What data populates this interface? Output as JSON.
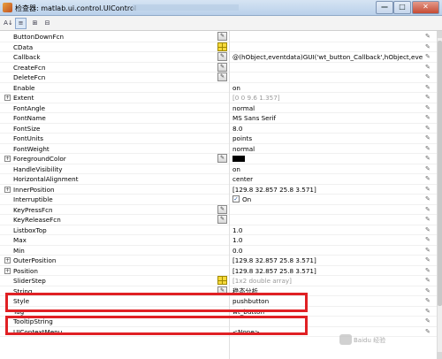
{
  "window": {
    "title": "检查器: matlab.ui.control.UIControl",
    "close_glyph": "✕",
    "min_glyph": "—",
    "max_glyph": "□"
  },
  "toolbar": {
    "buttons": [
      {
        "icon": "sort-categorized-icon",
        "glyph": "A↓"
      },
      {
        "icon": "sort-alphabetical-icon",
        "glyph": "≡"
      },
      {
        "icon": "expand-all-icon",
        "glyph": "⊞"
      },
      {
        "icon": "collapse-all-icon",
        "glyph": "⊟"
      }
    ]
  },
  "properties": [
    {
      "name": "ButtonDownFcn",
      "value": "",
      "edit": true
    },
    {
      "name": "CData",
      "value": "",
      "grid": true
    },
    {
      "name": "Callback",
      "value": "@(hObject,eventdata)GUI('wt_button_Callback',hObject,eventd...",
      "edit": true
    },
    {
      "name": "CreateFcn",
      "value": "",
      "edit": true
    },
    {
      "name": "DeleteFcn",
      "value": "",
      "edit": true
    },
    {
      "name": "Enable",
      "value": "on"
    },
    {
      "name": "Extent",
      "value": "[0 0 9.6 1.357]",
      "dim": true,
      "expand": true
    },
    {
      "name": "FontAngle",
      "value": "normal"
    },
    {
      "name": "FontName",
      "value": "MS Sans Serif"
    },
    {
      "name": "FontSize",
      "value": "8.0"
    },
    {
      "name": "FontUnits",
      "value": "points"
    },
    {
      "name": "FontWeight",
      "value": "normal"
    },
    {
      "name": "ForegroundColor",
      "value": "",
      "swatch": "#000000",
      "edit": true,
      "expand": true
    },
    {
      "name": "HandleVisibility",
      "value": "on"
    },
    {
      "name": "HorizontalAlignment",
      "value": "center"
    },
    {
      "name": "InnerPosition",
      "value": "[129.8 32.857 25.8 3.571]",
      "expand": true
    },
    {
      "name": "Interruptible",
      "value": "On",
      "checkbox": true
    },
    {
      "name": "KeyPressFcn",
      "value": "",
      "edit": true
    },
    {
      "name": "KeyReleaseFcn",
      "value": "",
      "edit": true
    },
    {
      "name": "ListboxTop",
      "value": "1.0"
    },
    {
      "name": "Max",
      "value": "1.0"
    },
    {
      "name": "Min",
      "value": "0.0"
    },
    {
      "name": "OuterPosition",
      "value": "[129.8 32.857 25.8 3.571]",
      "expand": true
    },
    {
      "name": "Position",
      "value": "[129.8 32.857 25.8 3.571]",
      "expand": true
    },
    {
      "name": "SliderStep",
      "value": "[1x2 double array]",
      "dim": true,
      "grid": true
    },
    {
      "name": "String",
      "value": "稳态分析",
      "edit": true
    },
    {
      "name": "Style",
      "value": "pushbutton"
    },
    {
      "name": "Tag",
      "value": "wt_button"
    },
    {
      "name": "TooltipString",
      "value": ""
    },
    {
      "name": "UIContextMenu",
      "value": "<None>"
    }
  ],
  "watermark": "Baidu 经验"
}
